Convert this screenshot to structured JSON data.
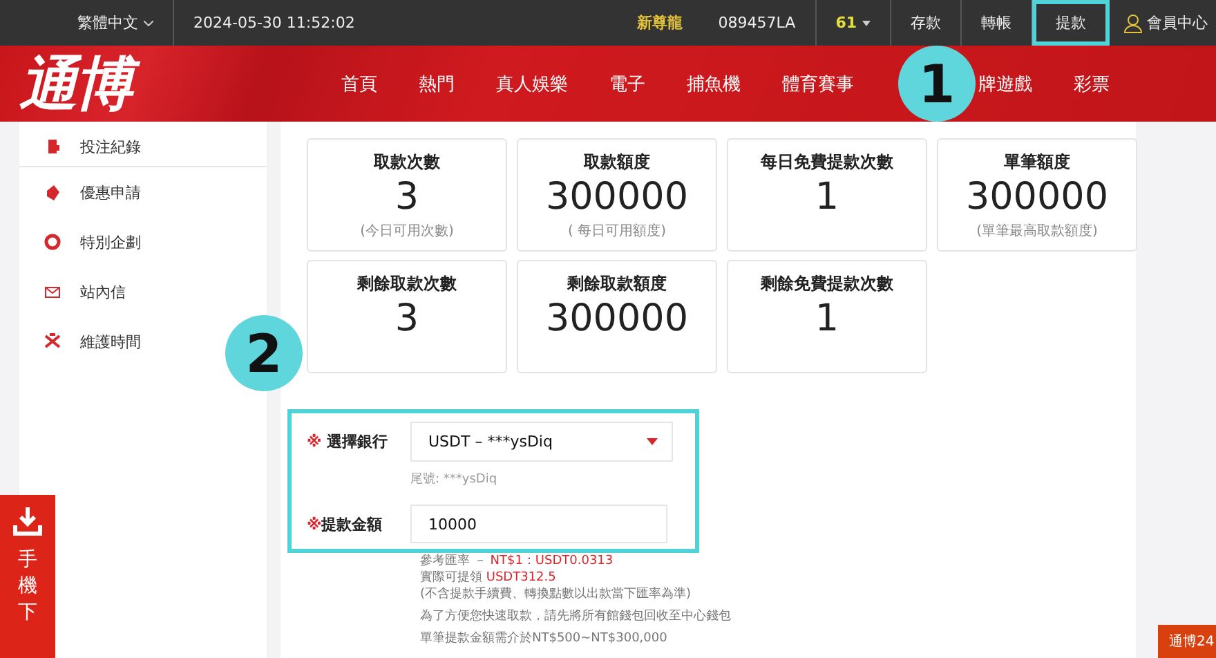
{
  "top_bar": {
    "language": "繁體中文",
    "datetime": "2024-05-30 11:52:02",
    "vip_level": "新尊龍",
    "username": "089457LA",
    "points": "61",
    "buttons": [
      {
        "label": "存款",
        "highlighted": false
      },
      {
        "label": "轉帳",
        "highlighted": false
      },
      {
        "label": "提款",
        "highlighted": true
      }
    ],
    "member_center": "會員中心"
  },
  "nav": {
    "logo": "通博",
    "items": [
      "首頁",
      "熱門",
      "真人娛樂",
      "電子",
      "捕魚機",
      "體育賽事",
      "牌遊戲",
      "彩票"
    ]
  },
  "sidebar": {
    "items": [
      "投注紀錄",
      "優惠申請",
      "特別企劃",
      "站內信",
      "維護時間"
    ]
  },
  "stats": [
    {
      "title": "取款次數",
      "value": "3",
      "note": "(今日可用次數)"
    },
    {
      "title": "取款額度",
      "value": "300000",
      "note": "(  每日可用額度)"
    },
    {
      "title": "每日免費提款次數",
      "value": "1"
    },
    {
      "title": "單筆額度",
      "value": "300000",
      "note": "(單筆最高取款額度)"
    },
    {
      "title": "剩餘取款次數",
      "value": "3"
    },
    {
      "title": "剩餘取款額度",
      "value": "300000"
    },
    {
      "title": "剩餘免費提款次數",
      "value": "1"
    }
  ],
  "form": {
    "highlighted": true,
    "required_mark": "※",
    "bank_label": "選擇銀行",
    "bank_value": "USDT – ***ysDiq",
    "tail_note": "尾號: ***ysDiq",
    "amount_label": "提款金額",
    "amount_value": "10000",
    "rate_label": "參考匯率 － ",
    "rate_value": "NT$1：USDT0.0313",
    "actual_label": "實際可提領 ",
    "actual_value": "USDT312.5",
    "notes": [
      "(不含提款手續費、轉換點數以出款當下匯率為準)",
      "為了方便您快速取款，請先將所有館錢包回收至中心錢包",
      "單筆提款金額需介於NT$500~NT$300,000"
    ]
  },
  "annotations": [
    "1",
    "2"
  ],
  "download_tab": "手機下",
  "corner_tab": "通博24"
}
